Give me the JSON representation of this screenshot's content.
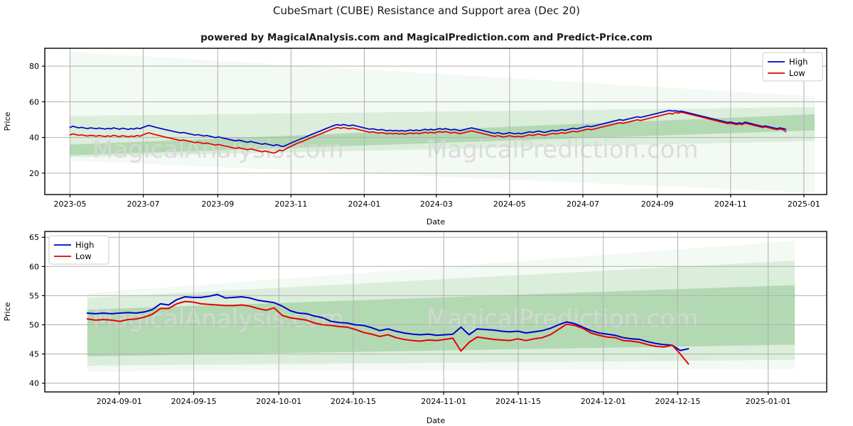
{
  "header": {
    "title": "CubeSmart (CUBE) Resistance and Support area (Dec 20)",
    "subtitle": "powered by MagicalAnalysis.com and MagicalPrediction.com and Predict-Price.com"
  },
  "watermarks": {
    "analysis": "MagicalAnalysis.com",
    "prediction": "MagicalPrediction.com",
    "color": "#d8d8d8"
  },
  "colors": {
    "high_line": "#0000cc",
    "low_line": "#e60000",
    "band_outer": "#cfe6cf",
    "band_mid": "#aed6ae",
    "band_inner": "#8cc68c",
    "grid": "#b0b0b0",
    "axis": "#000000",
    "background": "#ffffff"
  },
  "chart_data": [
    {
      "id": "top",
      "type": "line",
      "title": "",
      "xlabel": "Date",
      "ylabel": "Price",
      "ylim": [
        8,
        90
      ],
      "yticks": [
        20,
        40,
        60,
        80
      ],
      "xlim": [
        "2023-04-10",
        "2025-01-20"
      ],
      "xticks": [
        "2023-05",
        "2023-07",
        "2023-09",
        "2023-11",
        "2024-01",
        "2024-03",
        "2024-05",
        "2024-07",
        "2024-09",
        "2024-11",
        "2025-01"
      ],
      "grid": true,
      "legend_position": "upper-right",
      "legend": [
        "High",
        "Low"
      ],
      "series": [
        {
          "name": "High",
          "color": "#0000cc",
          "values": [
            45.6,
            46.3,
            45.8,
            45.4,
            45.7,
            45.3,
            45.0,
            45.4,
            45.2,
            44.9,
            45.3,
            45.0,
            44.7,
            45.1,
            44.8,
            45.4,
            45.0,
            44.6,
            45.2,
            44.9,
            44.5,
            45.0,
            44.7,
            45.3,
            44.9,
            45.6,
            46.2,
            46.8,
            46.4,
            45.9,
            45.5,
            45.1,
            44.7,
            44.3,
            44.0,
            43.6,
            43.2,
            42.9,
            42.5,
            42.8,
            42.4,
            42.0,
            41.7,
            41.3,
            41.6,
            41.2,
            40.8,
            41.1,
            40.7,
            40.3,
            39.9,
            40.3,
            39.9,
            39.5,
            39.2,
            38.8,
            38.4,
            38.1,
            38.5,
            38.1,
            37.7,
            37.3,
            37.8,
            37.4,
            37.0,
            36.6,
            36.2,
            36.6,
            36.2,
            35.8,
            35.4,
            36.0,
            35.5,
            34.9,
            35.4,
            36.2,
            36.9,
            37.6,
            38.3,
            39.0,
            39.6,
            40.3,
            41.0,
            41.7,
            42.3,
            43.0,
            43.6,
            44.3,
            45.0,
            45.6,
            46.3,
            46.9,
            47.2,
            46.8,
            47.3,
            46.9,
            46.5,
            47.0,
            46.6,
            46.2,
            45.8,
            45.4,
            45.0,
            44.6,
            44.9,
            44.5,
            44.1,
            44.5,
            44.1,
            43.7,
            44.1,
            43.7,
            44.0,
            43.6,
            43.9,
            43.5,
            43.9,
            44.2,
            43.8,
            44.2,
            43.8,
            44.2,
            44.6,
            44.2,
            44.6,
            44.2,
            44.6,
            45.0,
            44.6,
            45.0,
            44.6,
            44.2,
            44.6,
            44.2,
            43.8,
            44.2,
            44.6,
            45.0,
            45.4,
            45.0,
            44.6,
            44.2,
            43.8,
            43.4,
            43.0,
            42.6,
            42.3,
            42.7,
            42.3,
            41.9,
            42.3,
            42.7,
            42.3,
            42.0,
            42.4,
            42.0,
            42.4,
            42.8,
            43.2,
            42.8,
            43.2,
            43.6,
            43.2,
            42.8,
            43.2,
            43.6,
            44.0,
            43.6,
            44.0,
            44.4,
            44.0,
            44.4,
            44.8,
            45.2,
            44.8,
            45.2,
            45.6,
            46.0,
            46.4,
            46.0,
            46.4,
            46.8,
            47.2,
            47.6,
            48.0,
            48.4,
            48.8,
            49.2,
            49.6,
            50.0,
            49.6,
            50.0,
            50.4,
            50.8,
            51.2,
            51.6,
            51.2,
            51.6,
            52.0,
            52.4,
            52.8,
            53.2,
            53.6,
            54.0,
            54.4,
            54.8,
            55.2,
            54.8,
            55.0,
            54.6,
            54.8,
            54.4,
            54.0,
            53.6,
            53.2,
            52.8,
            52.4,
            52.0,
            51.6,
            51.2,
            50.8,
            50.4,
            50.0,
            49.6,
            49.2,
            48.8,
            48.4,
            48.6,
            48.2,
            47.8,
            48.2,
            47.8,
            48.6,
            48.2,
            47.8,
            47.4,
            47.0,
            46.6,
            46.2,
            46.5,
            46.1,
            45.7,
            45.3,
            45.0,
            45.4,
            45.0,
            44.6
          ]
        },
        {
          "name": "Low",
          "color": "#e60000",
          "values": [
            41.4,
            42.0,
            41.6,
            41.2,
            41.5,
            41.1,
            40.8,
            41.2,
            41.0,
            40.7,
            41.1,
            40.8,
            40.5,
            40.9,
            40.6,
            41.2,
            40.8,
            40.4,
            41.0,
            40.7,
            40.3,
            40.8,
            40.5,
            41.1,
            40.7,
            41.4,
            42.0,
            42.6,
            42.2,
            41.7,
            41.3,
            40.9,
            40.5,
            40.1,
            39.8,
            39.4,
            39.0,
            38.7,
            38.3,
            38.6,
            38.2,
            37.8,
            37.5,
            37.1,
            37.4,
            37.0,
            36.6,
            36.9,
            36.5,
            36.1,
            35.7,
            36.1,
            35.7,
            35.3,
            35.0,
            34.6,
            34.2,
            33.9,
            34.3,
            33.9,
            33.5,
            33.1,
            33.6,
            33.2,
            32.8,
            32.4,
            32.0,
            32.4,
            32.0,
            31.6,
            31.2,
            31.8,
            33.0,
            32.5,
            33.4,
            34.3,
            35.1,
            35.9,
            36.6,
            37.3,
            37.9,
            38.6,
            39.3,
            40.0,
            40.6,
            41.3,
            41.9,
            42.6,
            43.3,
            43.9,
            44.6,
            45.2,
            45.6,
            45.1,
            45.6,
            45.2,
            44.8,
            45.3,
            44.9,
            44.5,
            44.1,
            43.7,
            43.3,
            42.9,
            43.2,
            42.8,
            42.4,
            42.8,
            42.4,
            42.0,
            42.4,
            42.0,
            42.3,
            41.9,
            42.2,
            41.8,
            42.2,
            42.5,
            42.1,
            42.5,
            42.1,
            42.5,
            42.9,
            42.5,
            42.9,
            42.5,
            42.9,
            43.3,
            42.9,
            43.3,
            42.9,
            42.5,
            42.9,
            42.5,
            42.1,
            42.5,
            42.9,
            43.3,
            43.7,
            43.3,
            42.9,
            42.5,
            42.1,
            41.7,
            41.3,
            40.9,
            40.6,
            41.0,
            40.6,
            40.2,
            40.6,
            41.0,
            40.6,
            40.3,
            40.7,
            40.3,
            40.7,
            41.1,
            41.5,
            41.1,
            41.5,
            41.9,
            41.5,
            41.1,
            41.5,
            41.9,
            42.3,
            41.9,
            42.3,
            42.7,
            42.3,
            42.7,
            43.1,
            43.5,
            43.1,
            43.5,
            43.9,
            44.3,
            44.7,
            44.3,
            44.7,
            45.1,
            45.5,
            45.9,
            46.3,
            46.7,
            47.1,
            47.5,
            47.9,
            48.3,
            47.9,
            48.3,
            48.7,
            49.1,
            49.5,
            49.9,
            49.5,
            49.9,
            50.3,
            50.7,
            51.1,
            51.5,
            51.9,
            52.3,
            52.7,
            53.1,
            53.5,
            53.1,
            54.0,
            53.6,
            54.2,
            53.8,
            53.4,
            53.0,
            52.6,
            52.2,
            51.8,
            51.4,
            51.0,
            50.6,
            50.2,
            49.8,
            49.4,
            49.0,
            48.6,
            48.2,
            47.8,
            48.0,
            47.6,
            47.2,
            47.6,
            47.2,
            48.0,
            47.6,
            47.2,
            46.8,
            46.4,
            46.0,
            45.6,
            45.9,
            45.5,
            45.1,
            44.7,
            44.4,
            44.8,
            44.4,
            43.2
          ]
        }
      ],
      "bands": [
        {
          "name": "outer",
          "opacity": 0.25,
          "left_top": 88,
          "left_bottom": 27,
          "right_top": 63,
          "right_bottom": 9
        },
        {
          "name": "mid",
          "opacity": 0.35,
          "left_top": 52,
          "left_bottom": 29,
          "right_top": 57,
          "right_bottom": 38
        },
        {
          "name": "inner",
          "opacity": 0.5,
          "left_top": 36,
          "left_bottom": 30,
          "right_top": 53,
          "right_bottom": 44
        }
      ]
    },
    {
      "id": "bottom",
      "type": "line",
      "title": "",
      "xlabel": "Date",
      "ylabel": "Price",
      "ylim": [
        38.5,
        66
      ],
      "yticks": [
        40,
        45,
        50,
        55,
        60,
        65
      ],
      "xlim": [
        "2024-08-18",
        "2025-01-12"
      ],
      "xticks": [
        "2024-09-01",
        "2024-09-15",
        "2024-10-01",
        "2024-10-15",
        "2024-11-01",
        "2024-11-15",
        "2024-12-01",
        "2024-12-15",
        "2025-01-01"
      ],
      "grid": true,
      "legend_position": "upper-left",
      "legend": [
        "High",
        "Low"
      ],
      "series": [
        {
          "name": "High",
          "color": "#0000cc",
          "values": [
            52.0,
            51.9,
            52.0,
            51.9,
            52.0,
            52.1,
            52.0,
            52.2,
            52.6,
            53.6,
            53.4,
            54.3,
            54.8,
            54.7,
            54.7,
            54.9,
            55.2,
            54.6,
            54.7,
            54.8,
            54.6,
            54.2,
            54.0,
            53.8,
            53.2,
            52.4,
            52.0,
            51.9,
            51.5,
            51.2,
            50.6,
            50.4,
            50.3,
            50.0,
            49.9,
            49.5,
            49.0,
            49.3,
            48.9,
            48.6,
            48.4,
            48.3,
            48.4,
            48.2,
            48.3,
            48.4,
            49.6,
            48.3,
            49.3,
            49.2,
            49.1,
            48.9,
            48.8,
            48.9,
            48.6,
            48.8,
            49.0,
            49.4,
            50.0,
            50.5,
            50.2,
            49.6,
            49.0,
            48.6,
            48.4,
            48.2,
            47.8,
            47.6,
            47.5,
            47.1,
            46.8,
            46.6,
            46.5,
            45.6,
            45.9
          ]
        },
        {
          "name": "Low",
          "color": "#e60000",
          "values": [
            51.0,
            50.8,
            50.9,
            50.8,
            50.6,
            50.9,
            51.0,
            51.3,
            51.8,
            52.8,
            52.8,
            53.6,
            54.0,
            53.9,
            53.6,
            53.5,
            53.4,
            53.3,
            53.3,
            53.4,
            53.2,
            52.8,
            52.5,
            52.9,
            51.6,
            51.2,
            51.0,
            50.8,
            50.3,
            50.0,
            49.9,
            49.7,
            49.6,
            49.2,
            48.7,
            48.4,
            48.0,
            48.3,
            47.8,
            47.5,
            47.3,
            47.2,
            47.4,
            47.3,
            47.5,
            47.7,
            45.5,
            47.0,
            47.9,
            47.7,
            47.5,
            47.4,
            47.3,
            47.6,
            47.3,
            47.6,
            47.8,
            48.3,
            49.2,
            50.1,
            49.9,
            49.4,
            48.6,
            48.2,
            47.9,
            47.8,
            47.3,
            47.2,
            47.0,
            46.6,
            46.3,
            46.2,
            46.5,
            45.0,
            43.3
          ]
        }
      ],
      "bands": [
        {
          "name": "outer",
          "opacity": 0.25,
          "left_top": 55.4,
          "left_bottom": 42.0,
          "right_top": 64.4,
          "right_bottom": 42.4
        },
        {
          "name": "mid",
          "opacity": 0.35,
          "left_top": 54.6,
          "left_bottom": 43.0,
          "right_top": 61.0,
          "right_bottom": 44.0
        },
        {
          "name": "inner",
          "opacity": 0.5,
          "left_top": 52.6,
          "left_bottom": 44.6,
          "right_top": 56.8,
          "right_bottom": 46.6
        }
      ]
    }
  ]
}
